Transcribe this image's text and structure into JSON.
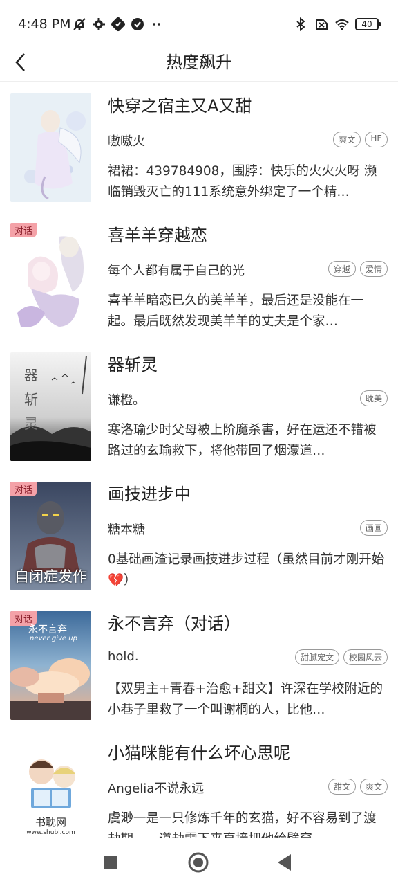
{
  "status": {
    "time": "4:48 PM",
    "battery": "40"
  },
  "header": {
    "title": "热度飙升"
  },
  "items": [
    {
      "title": "快穿之宿主又A又甜",
      "author": "嗷嗷火",
      "tags": [
        "爽文",
        "HE"
      ],
      "desc": "裙裙：439784908，围脖：快乐的火火火呀 濒临销毁灭亡的111系统意外绑定了一个精…",
      "dialog": false
    },
    {
      "title": "喜羊羊穿越恋",
      "author": "每个人都有属于自己的光",
      "tags": [
        "穿越",
        "爱情"
      ],
      "desc": "喜羊羊暗恋已久的美羊羊，最后还是没能在一起。最后既然发现美羊羊的丈夫是个家…",
      "dialog": true
    },
    {
      "title": "器斩灵",
      "author": "谦橙。",
      "tags": [
        "耽美"
      ],
      "desc": "寒洛瑜少时父母被上阶魔杀害，好在运还不错被路过的玄瑜救下，将他带回了烟濛道…",
      "dialog": false
    },
    {
      "title": "画技进步中",
      "author": "糖本糖",
      "tags": [
        "画画"
      ],
      "desc": "0基础画渣记录画技进步过程（虽然目前才刚开始💔）",
      "dialog": true,
      "cover_text": "自闭症发作"
    },
    {
      "title": "永不言弃（对话）",
      "author": "hold.",
      "tags": [
        "甜腻宠文",
        "校园风云"
      ],
      "desc": "【双男主+青春+治愈+甜文】许深在学校附近的小巷子里救了一个叫谢桐的人，比他…",
      "dialog": true,
      "cover_text": "永不言弃",
      "cover_sub": "never give up"
    },
    {
      "title": "小猫咪能有什么坏心思呢",
      "author": "Angelia不说永远",
      "tags": [
        "甜文",
        "爽文"
      ],
      "desc": "虞渺一是一只修炼千年的玄猫，好不容易到了渡劫期，一道劫雷下来直接把他给劈穿…",
      "dialog": false,
      "cover_text": "书耽网",
      "cover_sub": "www.shubl.com"
    }
  ],
  "dialog_label": "对话",
  "icons": {
    "back": "back-arrow-icon",
    "nav_square": "recent-apps-icon",
    "nav_circle": "home-icon",
    "nav_triangle": "back-nav-icon"
  }
}
